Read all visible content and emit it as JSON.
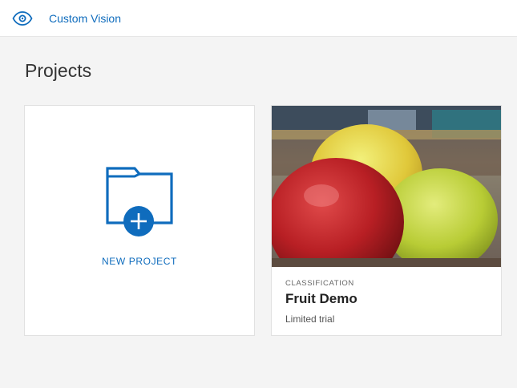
{
  "header": {
    "app_name": "Custom Vision",
    "icon": "eye-icon",
    "accent_color": "#0f6cbd"
  },
  "main": {
    "title": "Projects",
    "new_project": {
      "label": "NEW PROJECT",
      "icon": "folder-plus-icon"
    },
    "projects": [
      {
        "type": "CLASSIFICATION",
        "name": "Fruit Demo",
        "subtitle": "Limited trial",
        "thumbnail": "apples-photo"
      }
    ]
  }
}
